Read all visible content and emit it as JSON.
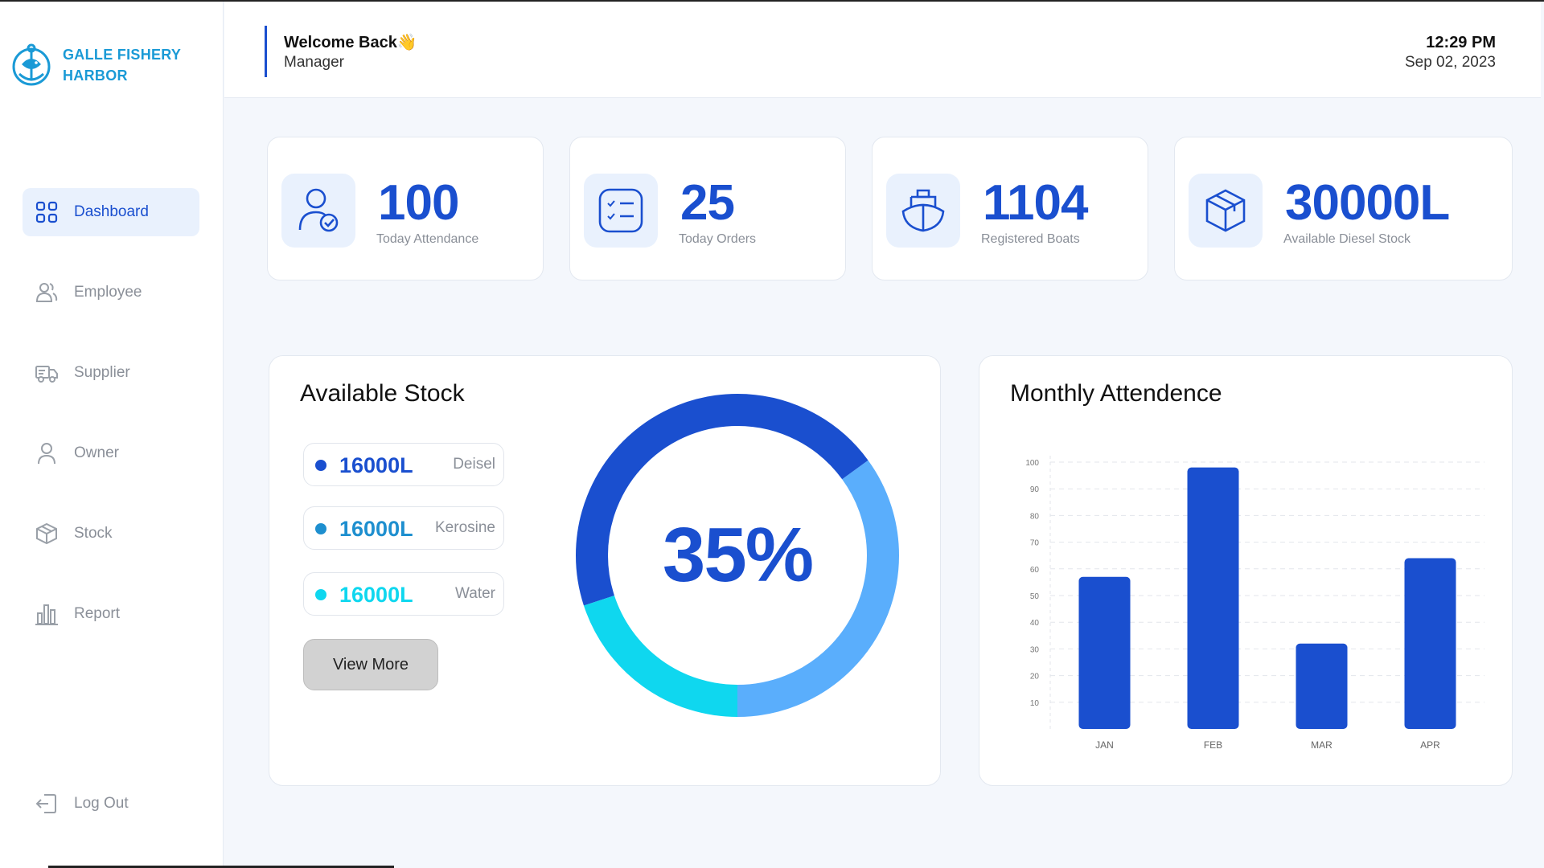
{
  "app": {
    "logo_line1": "GALLE FISHERY",
    "logo_line2": "HARBOR",
    "brand_color": "#1a9ad6",
    "accent_color": "#1a4fcf"
  },
  "sidebar": {
    "items": [
      {
        "label": "Dashboard",
        "icon": "grid-icon",
        "active": true
      },
      {
        "label": "Employee",
        "icon": "users-icon",
        "active": false
      },
      {
        "label": "Supplier",
        "icon": "truck-icon",
        "active": false
      },
      {
        "label": "Owner",
        "icon": "user-icon",
        "active": false
      },
      {
        "label": "Stock",
        "icon": "box-icon",
        "active": false
      },
      {
        "label": "Report",
        "icon": "bar-chart-icon",
        "active": false
      }
    ],
    "logout_label": "Log Out"
  },
  "header": {
    "welcome": "Welcome Back👋",
    "role": "Manager",
    "time": "12:29 PM",
    "date": "Sep 02, 2023"
  },
  "stats": [
    {
      "value": "100",
      "label": "Today Attendance",
      "icon": "user-check-icon"
    },
    {
      "value": "25",
      "label": "Today Orders",
      "icon": "checklist-icon"
    },
    {
      "value": "1104",
      "label": "Registered Boats",
      "icon": "boat-icon"
    },
    {
      "value": "30000L",
      "label": "Available Diesel Stock",
      "icon": "package-icon"
    }
  ],
  "stock": {
    "title": "Available Stock",
    "items": [
      {
        "amount": "16000L",
        "name": "Deisel",
        "color": "#1a4fcf"
      },
      {
        "amount": "16000L",
        "name": "Kerosine",
        "color": "#1e8fcf"
      },
      {
        "amount": "16000L",
        "name": "Water",
        "color": "#0fd7ef"
      }
    ],
    "view_more": "View More",
    "percent_label": "35%",
    "ring_segments": [
      {
        "fraction": 0.35,
        "color": "#5aaefc"
      },
      {
        "fraction": 0.45,
        "color": "#1a4fcf"
      },
      {
        "fraction": 0.2,
        "color": "#0fd7ef"
      }
    ]
  },
  "attendance": {
    "title": "Monthly Attendence"
  },
  "chart_data": {
    "type": "bar",
    "title": "Monthly Attendence",
    "categories": [
      "JAN",
      "FEB",
      "MAR",
      "APR"
    ],
    "values": [
      57,
      98,
      32,
      64
    ],
    "ylim": [
      0,
      100
    ],
    "yticks": [
      10,
      20,
      30,
      40,
      50,
      60,
      70,
      80,
      90,
      100
    ],
    "grid": true,
    "bar_color": "#1a4fcf"
  }
}
